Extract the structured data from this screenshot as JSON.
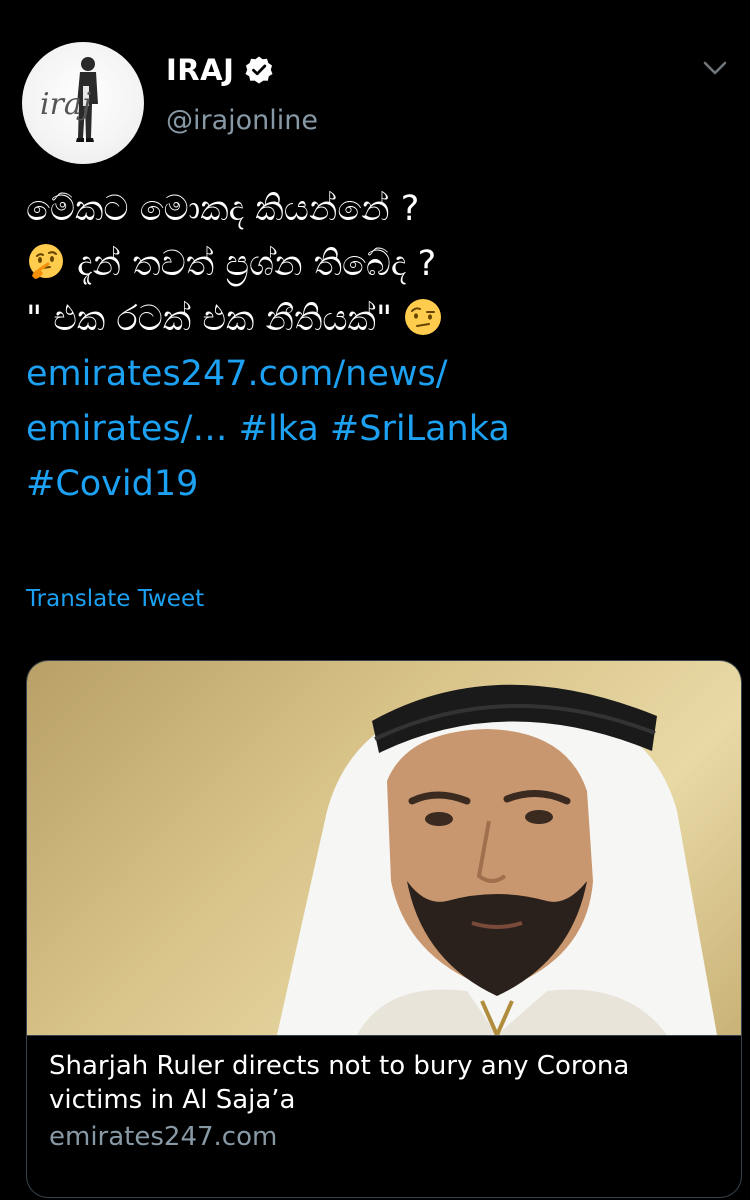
{
  "author": {
    "display_name": "IRAJ",
    "handle": "@irajonline",
    "verified": true,
    "avatar_text": "iraj"
  },
  "tweet": {
    "line1": "මේකට මොකද කියන්නේ ?",
    "line2_text": "දැන් තවත් ප්‍රශ්න තිබේද ?",
    "line3_text": "\" එක රටක් එක නීතියක්\"",
    "link_part1": "emirates247.com/news/",
    "link_part2": "emirates/…",
    "hashtag1": "#lka",
    "hashtag2": "#SriLanka",
    "hashtag3": "#Covid19",
    "emoji1": "thinking-face",
    "emoji2": "face-with-raised-eyebrow"
  },
  "translate_label": "Translate Tweet",
  "card": {
    "title": "Sharjah Ruler directs not to bury any Corona victims in Al Saja’a",
    "domain": "emirates247.com"
  },
  "colors": {
    "background": "#000000",
    "text": "#ffffff",
    "secondary": "#8899a6",
    "link": "#1da1f2",
    "border": "#38444d"
  }
}
